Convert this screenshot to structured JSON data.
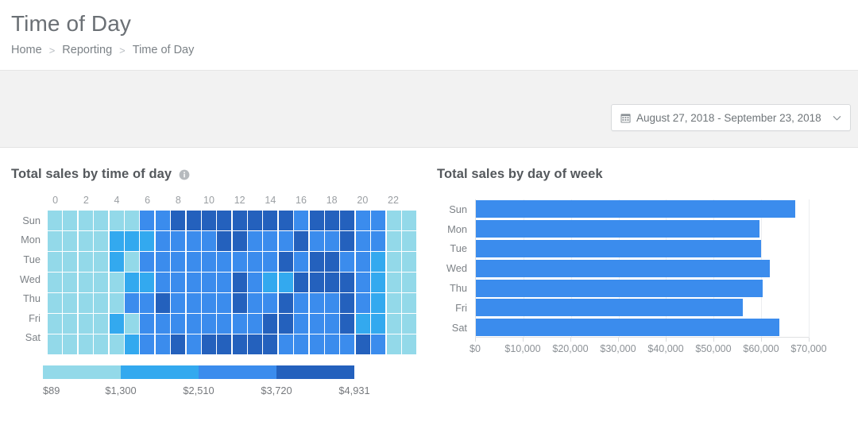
{
  "header": {
    "title": "Time of Day",
    "breadcrumb": [
      {
        "label": "Home"
      },
      {
        "label": "Reporting"
      },
      {
        "label": "Time of Day"
      }
    ],
    "breadcrumb_separator": ">"
  },
  "toolbar": {
    "date_range_label": "August 27, 2018 - September 23, 2018",
    "calendar_icon": "calendar-icon",
    "chevron_icon": "chevron-down-icon"
  },
  "panels": {
    "heatmap": {
      "title": "Total sales by time of day",
      "info_icon": "info-icon"
    },
    "bars": {
      "title": "Total sales by day of week"
    }
  },
  "chart_data": [
    {
      "type": "heatmap",
      "title": "Total sales by time of day",
      "xlabel": "",
      "ylabel": "",
      "x_ticks": [
        "0",
        "2",
        "4",
        "6",
        "8",
        "10",
        "12",
        "14",
        "16",
        "18",
        "20",
        "22"
      ],
      "x_tick_hours": [
        0,
        2,
        4,
        6,
        8,
        10,
        12,
        14,
        16,
        18,
        20,
        22
      ],
      "columns": [
        0,
        1,
        2,
        3,
        4,
        5,
        6,
        7,
        8,
        9,
        10,
        11,
        12,
        13,
        14,
        15,
        16,
        17,
        18,
        19,
        20,
        21,
        22,
        23
      ],
      "categories": [
        "Sun",
        "Mon",
        "Tue",
        "Wed",
        "Thu",
        "Fri",
        "Sat"
      ],
      "legend": {
        "position": "bottom",
        "tick_labels": [
          "$89",
          "$1,300",
          "$2,510",
          "$3,720",
          "$4,931"
        ],
        "tick_values": [
          89,
          1300,
          2510,
          3720,
          4931
        ],
        "band_colors": [
          "#93d9e9",
          "#33a9ef",
          "#3b8ced",
          "#2461bd"
        ]
      },
      "palette": {
        "l1": "#93d9e9",
        "l2": "#33a9ef",
        "l3": "#3b8ced",
        "l4": "#2461bd"
      },
      "rows": [
        {
          "day": "Sun",
          "levels": [
            1,
            1,
            1,
            1,
            1,
            1,
            3,
            3,
            4,
            4,
            4,
            4,
            4,
            4,
            4,
            4,
            3,
            4,
            4,
            4,
            3,
            3,
            1,
            1
          ]
        },
        {
          "day": "Mon",
          "levels": [
            1,
            1,
            1,
            1,
            2,
            2,
            2,
            3,
            3,
            3,
            3,
            4,
            4,
            3,
            3,
            3,
            4,
            3,
            3,
            4,
            3,
            3,
            1,
            1
          ]
        },
        {
          "day": "Tue",
          "levels": [
            1,
            1,
            1,
            1,
            2,
            1,
            3,
            3,
            3,
            3,
            3,
            3,
            3,
            3,
            3,
            4,
            3,
            4,
            4,
            3,
            3,
            2,
            1,
            1
          ]
        },
        {
          "day": "Wed",
          "levels": [
            1,
            1,
            1,
            1,
            1,
            2,
            2,
            3,
            3,
            3,
            3,
            3,
            4,
            3,
            2,
            2,
            4,
            4,
            4,
            4,
            3,
            2,
            1,
            1
          ]
        },
        {
          "day": "Thu",
          "levels": [
            1,
            1,
            1,
            1,
            1,
            3,
            3,
            4,
            3,
            3,
            3,
            3,
            4,
            3,
            3,
            4,
            3,
            3,
            3,
            4,
            3,
            2,
            1,
            1
          ]
        },
        {
          "day": "Fri",
          "levels": [
            1,
            1,
            1,
            1,
            2,
            1,
            3,
            3,
            3,
            3,
            3,
            3,
            3,
            3,
            4,
            4,
            3,
            3,
            3,
            4,
            2,
            2,
            1,
            1
          ]
        },
        {
          "day": "Sat",
          "levels": [
            1,
            1,
            1,
            1,
            1,
            2,
            3,
            3,
            4,
            3,
            4,
            4,
            4,
            4,
            4,
            3,
            3,
            3,
            3,
            3,
            4,
            3,
            1,
            1
          ]
        }
      ]
    },
    {
      "type": "bar",
      "orientation": "horizontal",
      "title": "Total sales by day of week",
      "xlabel": "",
      "ylabel": "",
      "categories": [
        "Sun",
        "Mon",
        "Tue",
        "Wed",
        "Thu",
        "Fri",
        "Sat"
      ],
      "values": [
        67200,
        59600,
        60000,
        61800,
        60300,
        56100,
        63900
      ],
      "xlim": [
        0,
        70000
      ],
      "x_tick_labels": [
        "$0",
        "$10,000",
        "$20,000",
        "$30,000",
        "$40,000",
        "$50,000",
        "$60,000",
        "$70,000"
      ],
      "x_tick_values": [
        0,
        10000,
        20000,
        30000,
        40000,
        50000,
        60000,
        70000
      ],
      "bar_color": "#3b8ced",
      "grid": true,
      "legend": null
    }
  ]
}
